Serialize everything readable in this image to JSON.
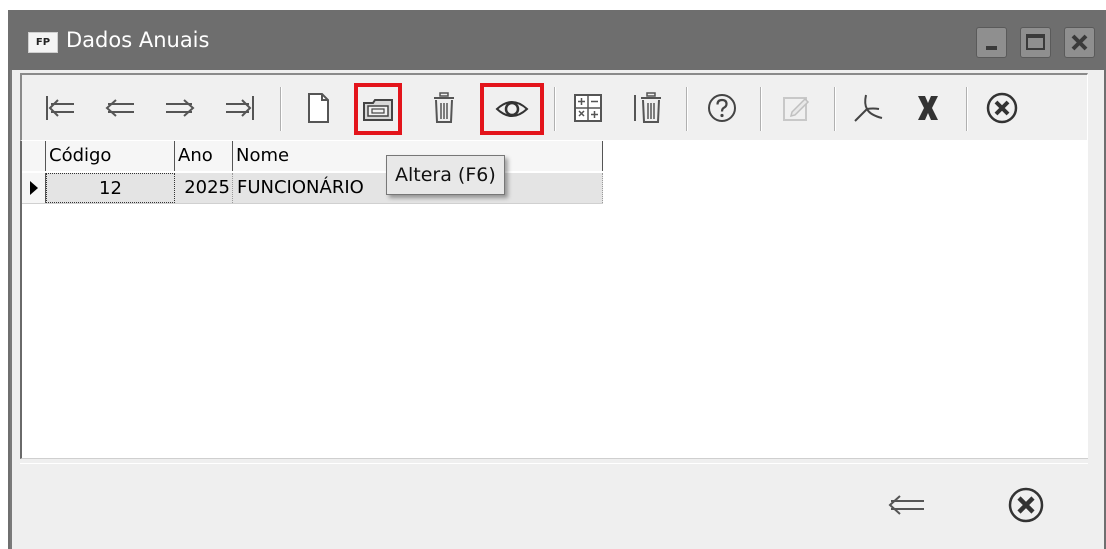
{
  "window": {
    "title": "Dados Anuais",
    "app_icon_text": "FP"
  },
  "toolbar": {
    "buttons": [
      {
        "name": "first-record",
        "icon": "first-arrow-icon"
      },
      {
        "name": "previous-record",
        "icon": "left-arrow-icon"
      },
      {
        "name": "next-record",
        "icon": "right-arrow-icon"
      },
      {
        "name": "last-record",
        "icon": "last-arrow-icon"
      },
      {
        "name": "new-record",
        "icon": "new-document-icon"
      },
      {
        "name": "edit-record",
        "icon": "edit-folder-icon",
        "highlighted": true
      },
      {
        "name": "delete-record",
        "icon": "trash-icon"
      },
      {
        "name": "view-record",
        "icon": "eye-icon",
        "highlighted": true
      },
      {
        "name": "calculator",
        "icon": "calculator-icon"
      },
      {
        "name": "delete-all",
        "icon": "trash-bar-icon"
      },
      {
        "name": "help",
        "icon": "help-icon"
      },
      {
        "name": "edit-note",
        "icon": "pencil-box-icon",
        "disabled": true
      },
      {
        "name": "pdf-export",
        "icon": "pdf-icon"
      },
      {
        "name": "excel-export",
        "icon": "excel-x-icon"
      },
      {
        "name": "close",
        "icon": "close-circle-icon"
      }
    ]
  },
  "grid": {
    "columns": [
      "Código",
      "Ano",
      "Nome"
    ],
    "rows": [
      {
        "codigo": "12",
        "ano": "2025",
        "nome": "FUNCIONÁRIO"
      }
    ]
  },
  "tooltip": {
    "text": "Altera (F6)"
  },
  "footer": {
    "buttons": [
      {
        "name": "back",
        "icon": "left-arrow-icon"
      },
      {
        "name": "close",
        "icon": "close-circle-icon"
      }
    ]
  },
  "colors": {
    "titlebar": "#6e6e6e",
    "highlight": "#e3141b",
    "window_bg": "#efefef"
  }
}
